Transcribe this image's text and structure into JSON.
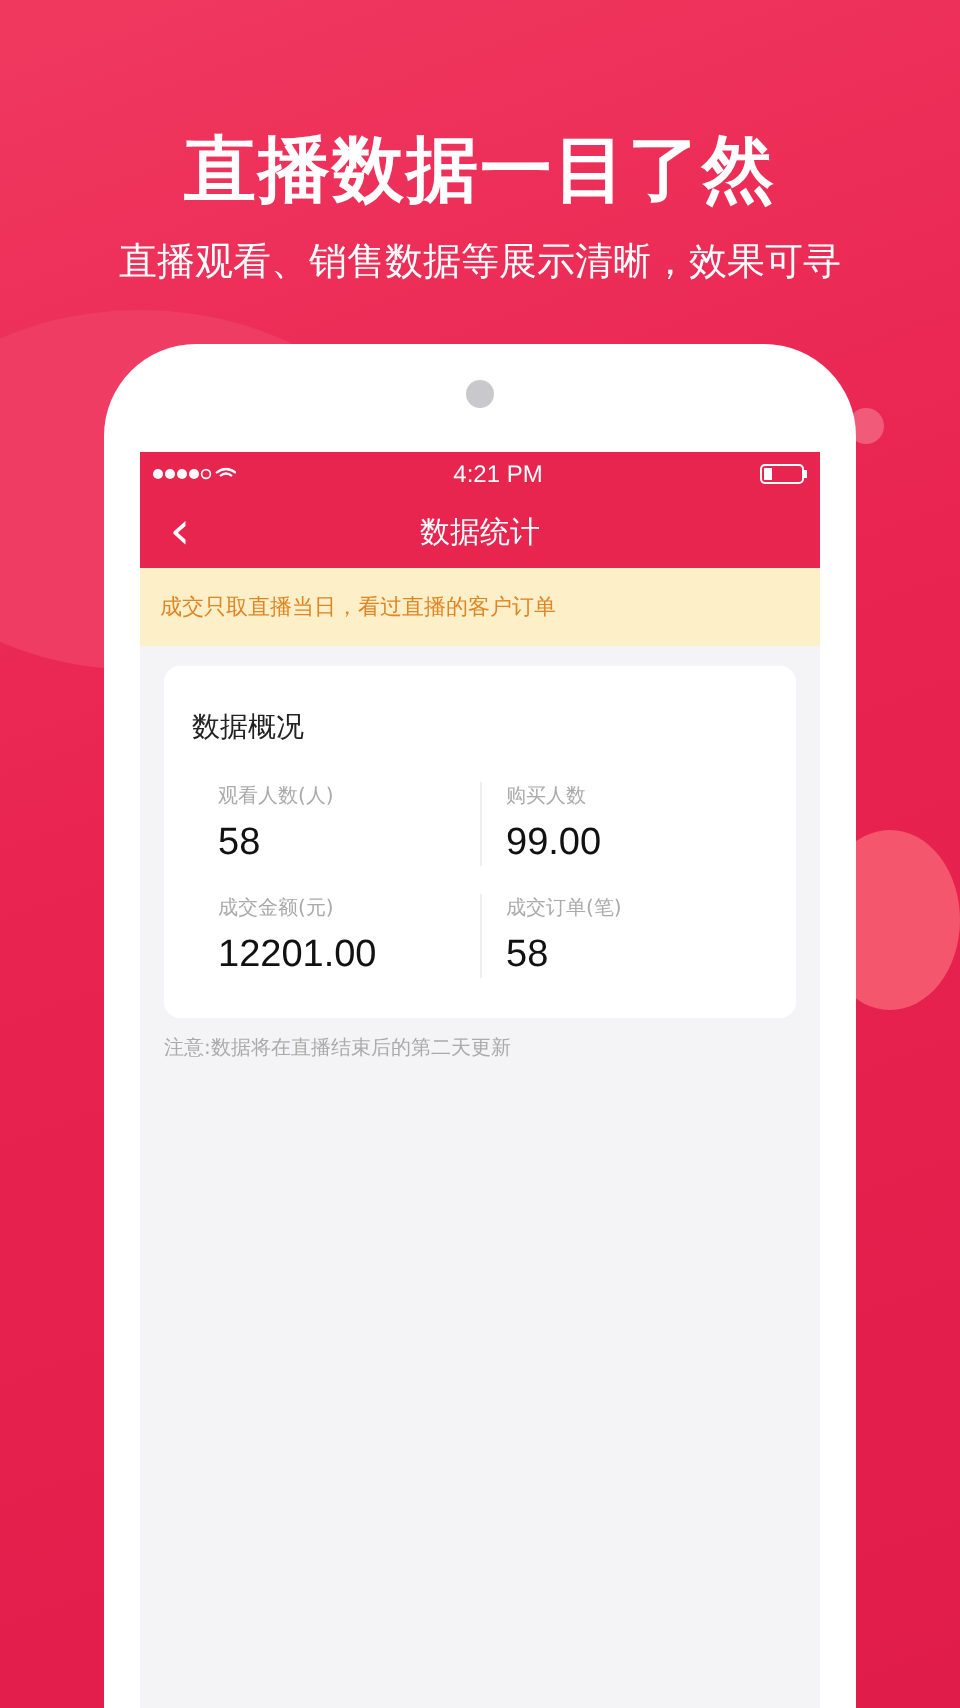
{
  "promo": {
    "headline": "直播数据一目了然",
    "subtitle": "直播观看、销售数据等展示清晰，效果可寻"
  },
  "status_bar": {
    "time": "4:21 PM"
  },
  "nav_bar": {
    "back": "‹",
    "title": "数据统计"
  },
  "notice": "成交只取直播当日，看过直播的客户订单",
  "overview": {
    "title": "数据概况",
    "stats": [
      {
        "label": "观看人数(人)",
        "value": "58"
      },
      {
        "label": "购买人数",
        "value": "99.00"
      },
      {
        "label": "成交金额(元)",
        "value": "12201.00"
      },
      {
        "label": "成交订单(笔)",
        "value": "58"
      }
    ]
  },
  "footnote": "注意:数据将在直播结束后的第二天更新"
}
